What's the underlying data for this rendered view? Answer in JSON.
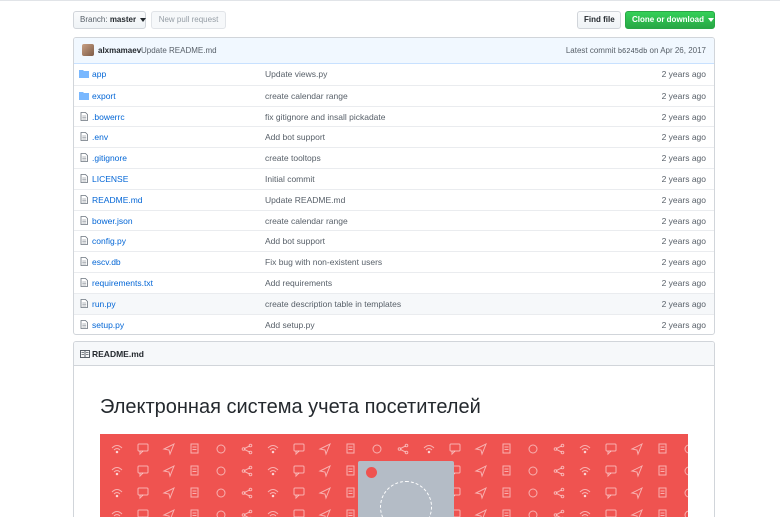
{
  "toolbar": {
    "branch_label": "Branch:",
    "branch_value": "master",
    "new_pr_label": "New pull request",
    "find_file_label": "Find file",
    "clone_label": "Clone or download"
  },
  "commit": {
    "author": "alxmamaev",
    "message": "Update README.md",
    "latest_label": "Latest commit",
    "sha": "b6245db",
    "on_label": "on",
    "date": "Apr 26, 2017"
  },
  "files": [
    {
      "type": "folder",
      "name": "app",
      "message": "Update views.py",
      "age": "2 years ago"
    },
    {
      "type": "folder",
      "name": "export",
      "message": "create calendar range",
      "age": "2 years ago"
    },
    {
      "type": "file",
      "name": ".bowerrc",
      "message": "fix gitignore and insall pickadate",
      "age": "2 years ago"
    },
    {
      "type": "file",
      "name": ".env",
      "message": "Add bot support",
      "age": "2 years ago"
    },
    {
      "type": "file",
      "name": ".gitignore",
      "message": "create tooltops",
      "age": "2 years ago"
    },
    {
      "type": "file",
      "name": "LICENSE",
      "message": "Initial commit",
      "age": "2 years ago"
    },
    {
      "type": "file",
      "name": "README.md",
      "message": "Update README.md",
      "age": "2 years ago"
    },
    {
      "type": "file",
      "name": "bower.json",
      "message": "create calendar range",
      "age": "2 years ago"
    },
    {
      "type": "file",
      "name": "config.py",
      "message": "Add bot support",
      "age": "2 years ago"
    },
    {
      "type": "file",
      "name": "escv.db",
      "message": "Fix bug with non-existent users",
      "age": "2 years ago"
    },
    {
      "type": "file",
      "name": "requirements.txt",
      "message": "Add requirements",
      "age": "2 years ago"
    },
    {
      "type": "file",
      "name": "run.py",
      "message": "create description table in templates",
      "age": "2 years ago",
      "highlighted": true
    },
    {
      "type": "file",
      "name": "setup.py",
      "message": "Add setup.py",
      "age": "2 years ago"
    }
  ],
  "readme": {
    "file_label": "README.md",
    "heading": "Электронная система учета посетителей"
  },
  "colors": {
    "link": "#0366d6",
    "clone_button": "#28a745",
    "banner": "#ef5350",
    "folder_icon": "#79b8ff"
  }
}
